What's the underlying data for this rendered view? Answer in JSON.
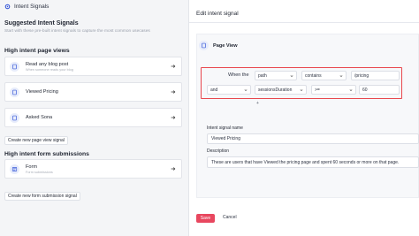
{
  "sidebar": {
    "header": "Intent Signals",
    "title": "Suggested Intent Signals",
    "description": "Start with these pre-built intent signals to capture the most common usecases",
    "views_heading": "High intent page views",
    "views": [
      {
        "label": "Read any blog post",
        "sublabel": "When someone reads your blog"
      },
      {
        "label": "Viewed Pricing",
        "sublabel": ""
      },
      {
        "label": "Asked Sona",
        "sublabel": ""
      }
    ],
    "create_view_button": "Create new page view signal",
    "forms_heading": "High intent form submissions",
    "forms": [
      {
        "label": "Form",
        "sublabel": "Form submissions"
      }
    ],
    "create_form_button": "Create new form submission signal"
  },
  "editor": {
    "title": "Edit intent signal",
    "block_label": "Page View",
    "row1": {
      "prefix": "When the",
      "field": "path",
      "operator": "contains",
      "value": "/pricing"
    },
    "row2": {
      "connector": "and",
      "field": "sessionsDuration",
      "operator": ">=",
      "value": "60"
    },
    "add_glyph": "+",
    "name_label": "Intent signal name",
    "name_value": "Viewed Pricing",
    "desc_label": "Description",
    "desc_value": "These are users that have Viewed the pricing page and spent 60 seconds or more on that page.",
    "save_label": "Save",
    "cancel_label": "Cancel"
  },
  "colors": {
    "highlight": "#e8474d",
    "primary": "#e8475f",
    "icon_bg": "#e7ecfb"
  }
}
